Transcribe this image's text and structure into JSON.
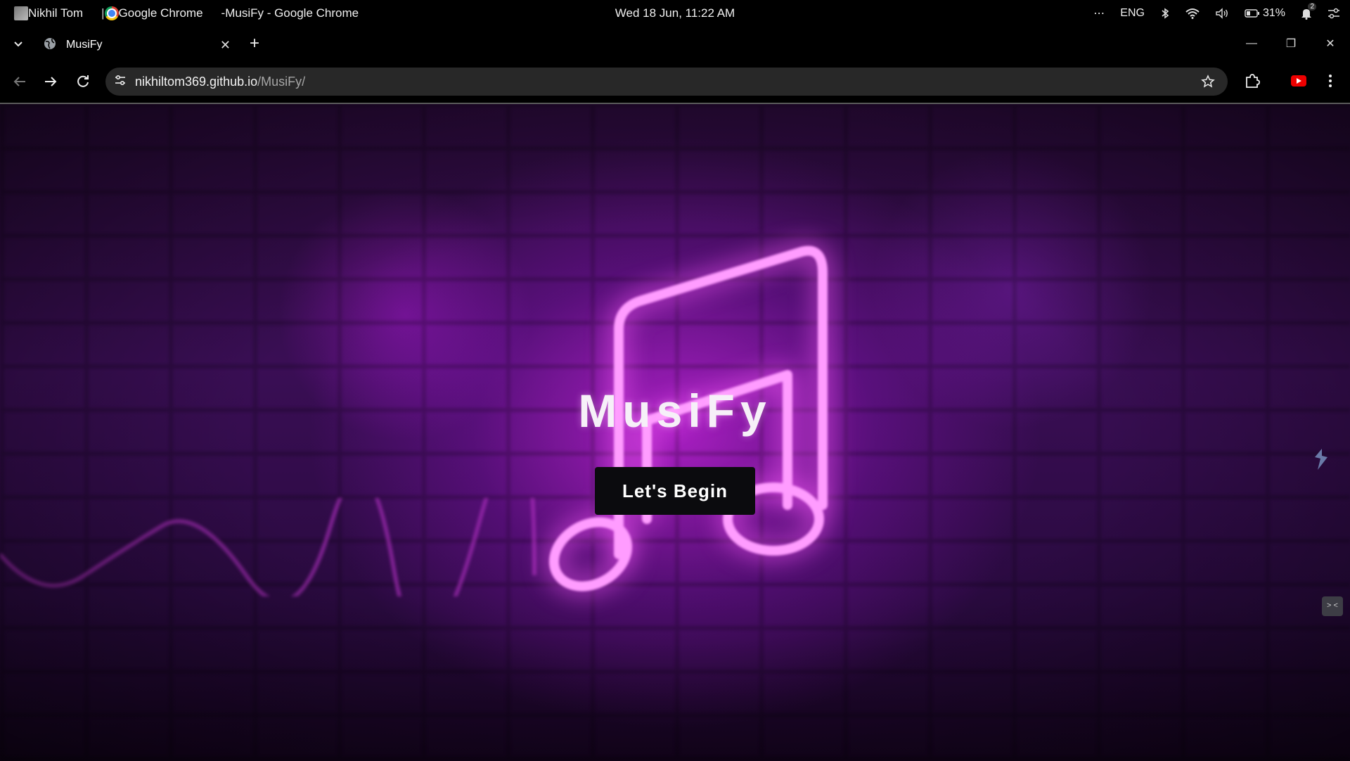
{
  "system_bar": {
    "user": "Nikhil Tom",
    "separator": "|",
    "app_name": "Google Chrome",
    "dash": "-",
    "window_title": "MusiFy - Google Chrome",
    "datetime": "Wed 18 Jun, 11:22 AM",
    "overflow": "⋯",
    "language": "ENG",
    "battery": "31%",
    "notification_count": "2"
  },
  "browser": {
    "tab_title": "MusiFy",
    "tab_close": "✕",
    "new_tab": "+",
    "url_host": "nikhiltom369.github.io",
    "url_path": "/MusiFy/",
    "window_controls": {
      "minimize": "—",
      "restore": "❐",
      "close": "✕"
    }
  },
  "page": {
    "title": "MusiFy",
    "button_label": "Let's Begin",
    "chat_icon_text": "> <"
  }
}
